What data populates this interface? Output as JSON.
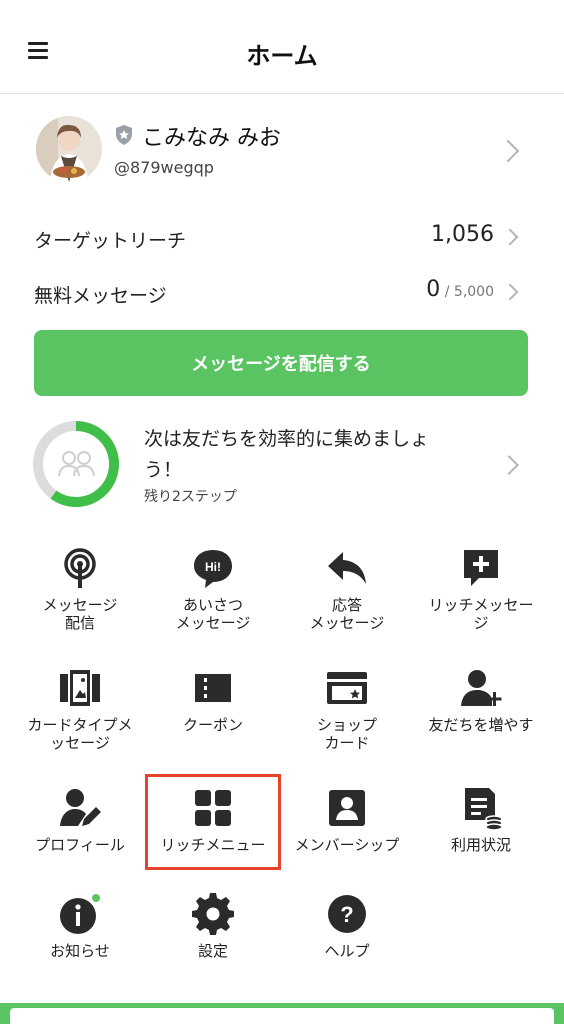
{
  "header": {
    "title": "ホーム"
  },
  "profile": {
    "name": "こみなみ みお",
    "id": "@879wegqp"
  },
  "stats": [
    {
      "label": "ターゲットリーチ",
      "value": "1,056",
      "sub": ""
    },
    {
      "label": "無料メッセージ",
      "value": "0",
      "sub": " / 5,000"
    }
  ],
  "send_button": "メッセージを配信する",
  "progress": {
    "title": "次は友だちを効率的に集めましょう！",
    "sub": "残り2ステップ",
    "fraction": 0.6
  },
  "menu": [
    {
      "label": "メッセージ\n配信",
      "icon": "broadcast-icon"
    },
    {
      "label": "あいさつ\nメッセージ",
      "icon": "greeting-bubble-icon"
    },
    {
      "label": "応答\nメッセージ",
      "icon": "reply-arrow-icon"
    },
    {
      "label": "リッチメッセー\nジ",
      "icon": "rich-message-plus-icon"
    },
    {
      "label": "カードタイプメ\nッセージ",
      "icon": "card-type-icon"
    },
    {
      "label": "クーポン",
      "icon": "coupon-icon"
    },
    {
      "label": "ショップ\nカード",
      "icon": "shop-card-icon"
    },
    {
      "label": "友だちを増やす",
      "icon": "add-friend-icon"
    },
    {
      "label": "プロフィール",
      "icon": "profile-edit-icon"
    },
    {
      "label": "リッチメニュー",
      "icon": "rich-menu-grid-icon"
    },
    {
      "label": "メンバーシップ",
      "icon": "membership-icon"
    },
    {
      "label": "利用状況",
      "icon": "usage-icon"
    },
    {
      "label": "お知らせ",
      "icon": "info-icon"
    },
    {
      "label": "設定",
      "icon": "gear-icon"
    },
    {
      "label": "ヘルプ",
      "icon": "help-icon"
    }
  ],
  "colors": {
    "accent": "#5ac463",
    "highlight": "#e5432c",
    "icon": "#2b2b2b"
  }
}
